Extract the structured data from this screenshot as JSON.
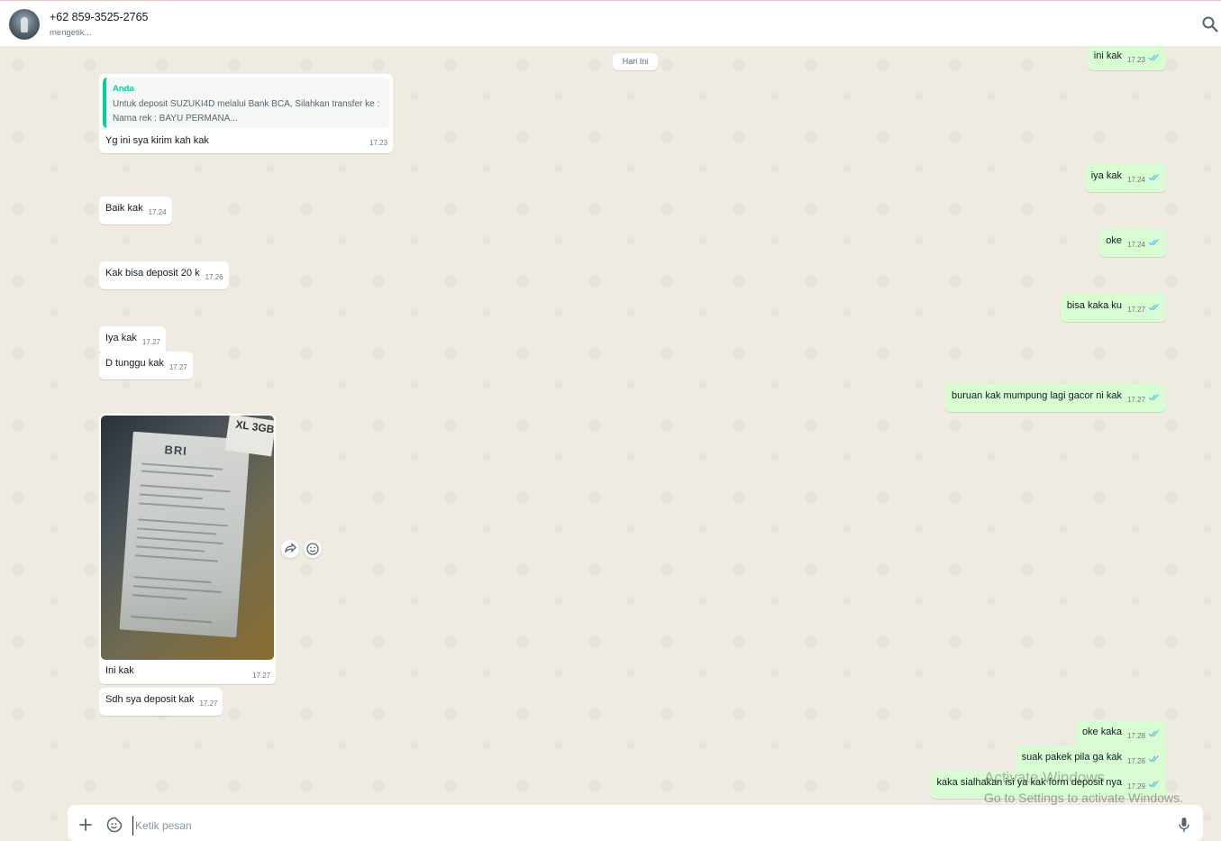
{
  "header": {
    "contact_name": "+62 859-3525-2765",
    "contact_status": "mengetik..."
  },
  "date_separator": "Hari Ini",
  "quoted_message": {
    "author": "Anda",
    "line1": "Untuk deposit SUZUKI4D melalui Bank BCA, Silahkan transfer ke :",
    "line2": "Nama rek : BAYU PERMANA...",
    "reply_text": "Yg ini sya kirim kah kak",
    "time": "17.23"
  },
  "incoming": [
    {
      "text": "Baik kak",
      "time": "17.24"
    },
    {
      "text": "Kak bisa deposit 20 k",
      "time": "17.26"
    },
    {
      "text": "Iya kak",
      "time": "17.27"
    },
    {
      "text": "D tunggu kak",
      "time": "17.27"
    },
    {
      "text": "Sdh sya deposit kak",
      "time": "17.27"
    }
  ],
  "image_message": {
    "photo_logo": "BRI",
    "photo_tag": "XL 3GB",
    "caption": "Ini kak",
    "time": "17.27"
  },
  "outgoing": [
    {
      "text": "ini kak",
      "time": "17.23"
    },
    {
      "text": "iya kak",
      "time": "17.24"
    },
    {
      "text": "oke",
      "time": "17.24"
    },
    {
      "text": "bisa kaka ku",
      "time": "17.27"
    },
    {
      "text": "buruan kak mumpung lagi gacor ni kak",
      "time": "17.27"
    },
    {
      "text": "oke kaka",
      "time": "17.28"
    },
    {
      "text": "suak pakek pila ga kak",
      "time": "17.28"
    },
    {
      "text": "kaka sialhakan isi ya kak form deposit nya",
      "time": "17.29"
    }
  ],
  "composer": {
    "placeholder": "Ketik pesan"
  },
  "watermark": {
    "line1": "Activate Windows",
    "line2": "Go to Settings to activate Windows."
  },
  "colors": {
    "outgoing_bubble": "#d9fdd3",
    "incoming_bubble": "#ffffff",
    "quote_accent": "#06cf9c",
    "read_ticks": "#53bdeb",
    "chat_background": "#efeae2"
  },
  "icons": {
    "search": "search-icon",
    "plus": "plus-icon",
    "sticker": "sticker-icon",
    "mic": "mic-icon",
    "forward": "forward-icon",
    "emoji": "emoji-icon",
    "ticks": "double-check-icon"
  }
}
